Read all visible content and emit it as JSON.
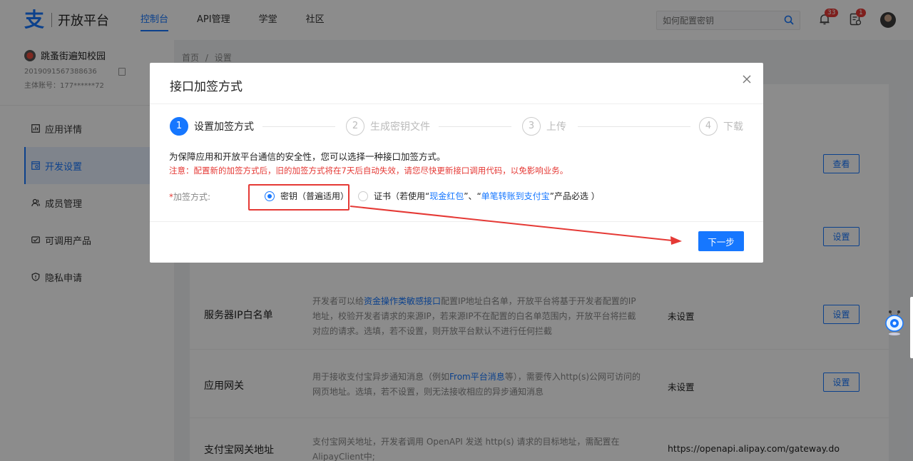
{
  "header": {
    "logo_text": "开放平台",
    "nav": [
      {
        "label": "控制台",
        "active": true
      },
      {
        "label": "API管理",
        "active": false
      },
      {
        "label": "学堂",
        "active": false
      },
      {
        "label": "社区",
        "active": false
      }
    ],
    "search_placeholder": "如何配置密钥",
    "notification_count": "33",
    "task_count": "1"
  },
  "sidebar": {
    "app_name": "跳蚤街遍知校园",
    "app_id": "2019091567388636",
    "main_account": "主体账号：177******72",
    "items": [
      {
        "label": "应用详情",
        "icon": "chart-icon",
        "active": false
      },
      {
        "label": "开发设置",
        "icon": "code-icon",
        "active": true
      },
      {
        "label": "成员管理",
        "icon": "users-icon",
        "active": false
      },
      {
        "label": "可调用产品",
        "icon": "product-icon",
        "active": false
      },
      {
        "label": "隐私申请",
        "icon": "shield-icon",
        "active": false
      }
    ]
  },
  "breadcrumb": {
    "home": "首页",
    "sep": "/",
    "current": "设置"
  },
  "settings": {
    "view_label": "查看",
    "set_label": "设置",
    "rows": [
      {
        "title": "服务器IP白名单",
        "desc_pre": "开发者可以给",
        "desc_link": "资金操作类敏感接口",
        "desc_post": "配置IP地址白名单，开放平台将基于开发者配置的IP地址，校验开发者请求的来源IP，若来源IP不在配置的白名单范围内，开放平台将拦截对应的请求。选填，若不设置，则开放平台默认不进行任何拦截",
        "status": "未设置",
        "button": "设置"
      },
      {
        "title": "应用网关",
        "desc_pre": "用于接收支付宝异步通知消息（例如",
        "desc_link": "From平台消息",
        "desc_post": "等），需要传入http(s)公网可访问的网页地址。选填，若不设置，则无法接收相应的异步通知消息",
        "status": "未设置",
        "button": "设置"
      },
      {
        "title": "支付宝网关地址",
        "desc_pre": "支付宝网关地址，开发者调用 OpenAPI 发送 http(s) 请求的目标地址，需配置在AlipayClient中;",
        "desc_link": "",
        "desc_post": "",
        "status": "https://openapi.alipay.com/gateway.do",
        "button": ""
      }
    ]
  },
  "modal": {
    "title": "接口加签方式",
    "steps": [
      {
        "num": "1",
        "label": "设置加签方式",
        "active": true
      },
      {
        "num": "2",
        "label": "生成密钥文件",
        "active": false
      },
      {
        "num": "3",
        "label": "上传",
        "active": false
      },
      {
        "num": "4",
        "label": "下载",
        "active": false
      }
    ],
    "tip": "为保障应用和开放平台通信的安全性，您可以选择一种接口加签方式。",
    "warning": "注意：配置新的加签方式后，旧的加签方式将在7天后自动失效，请您尽快更新接口调用代码，以免影响业务。",
    "field_required_mark": "*",
    "field_label": "加签方式:",
    "option_key": "密钥（普遍适用）",
    "option_cert_pre": "证书（若使用“",
    "option_cert_link1": "现金红包",
    "option_cert_mid": "”、“",
    "option_cert_link2": "单笔转账到支付宝",
    "option_cert_post": "”产品必选 ）",
    "next_button": "下一步"
  },
  "colors": {
    "primary": "#1677ff",
    "warning": "#e53935",
    "annotation": "#e53935"
  }
}
